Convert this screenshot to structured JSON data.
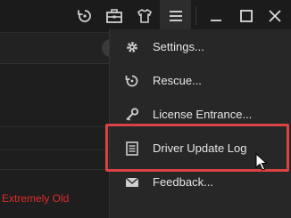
{
  "titlebar": {
    "icons": [
      "refresh-icon",
      "toolbox-icon",
      "shirt-icon",
      "menu-icon",
      "minimize-icon",
      "maximize-icon",
      "close-icon"
    ]
  },
  "background": {
    "status_text": "Extremely Old",
    "status_color": "#e12b2b"
  },
  "menu": {
    "items": [
      {
        "label": "Settings...",
        "icon": "gear-icon"
      },
      {
        "label": "Rescue...",
        "icon": "rescue-icon"
      },
      {
        "label": "License Entrance...",
        "icon": "key-icon"
      },
      {
        "label": "Driver Update Log",
        "icon": "log-icon",
        "highlighted": true
      },
      {
        "label": "Feedback...",
        "icon": "mail-icon"
      }
    ]
  },
  "colors": {
    "accent_highlight": "#d94343",
    "menu_bg": "#272727",
    "text": "#e6e6e6"
  }
}
